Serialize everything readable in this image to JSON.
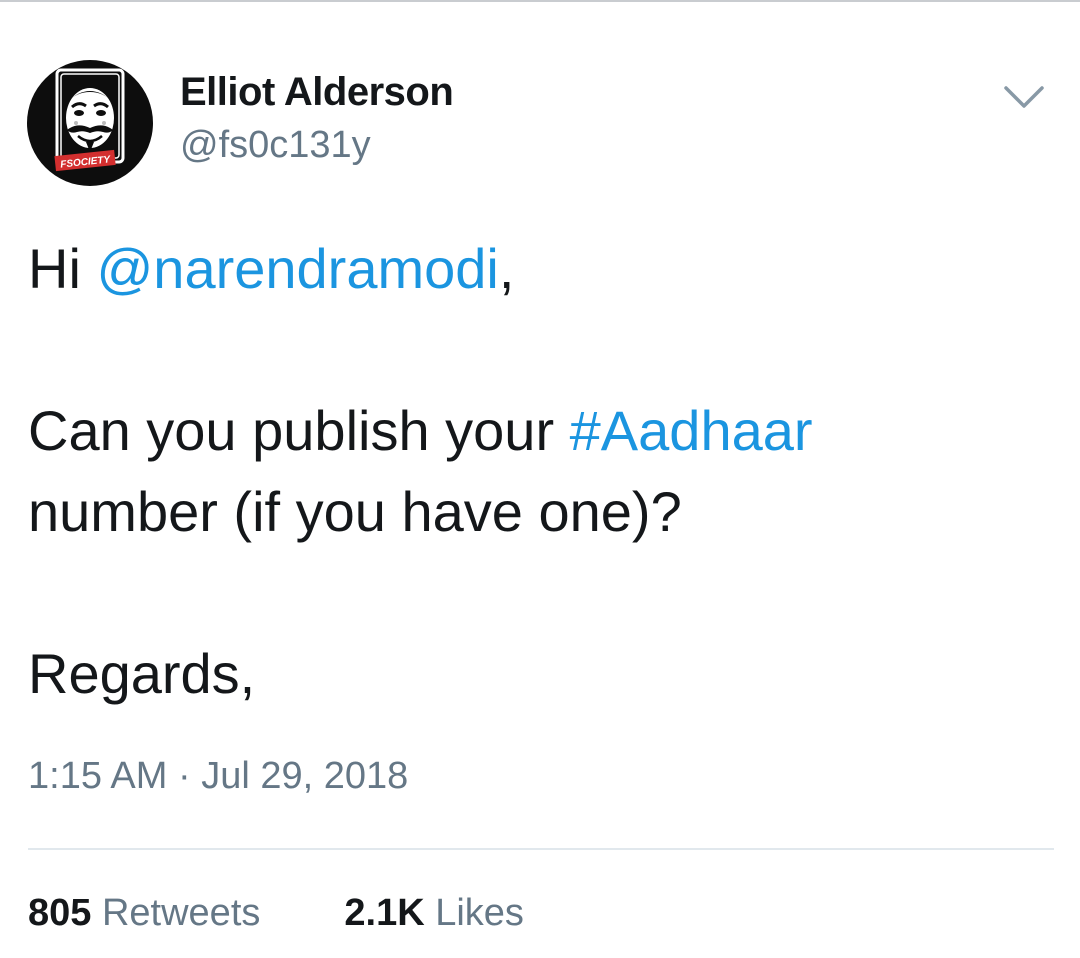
{
  "tweet": {
    "author": {
      "display_name": "Elliot Alderson",
      "handle": "@fs0c131y",
      "avatar_caption": "FSOCIETY"
    },
    "body": {
      "line1_prefix": "Hi ",
      "mention": "@narendramodi",
      "line1_suffix": ",",
      "line2_prefix": "Can you publish your ",
      "hashtag": "#Aadhaar",
      "line3": "number (if you have one)?",
      "line4": "Regards,"
    },
    "timestamp": "1:15 AM · Jul 29, 2018",
    "stats": {
      "retweets_count": "805",
      "retweets_label": "Retweets",
      "likes_count": "2.1K",
      "likes_label": "Likes"
    }
  },
  "icons": {
    "menu": "chevron-down-icon",
    "avatar": "fsociety-mask-logo"
  },
  "colors": {
    "link": "#1b95e0",
    "text": "#14171a",
    "secondary": "#657786",
    "divider": "#e1e8ed",
    "avatar_bg": "#0d0d0d",
    "logo_red": "#d32f2f"
  }
}
